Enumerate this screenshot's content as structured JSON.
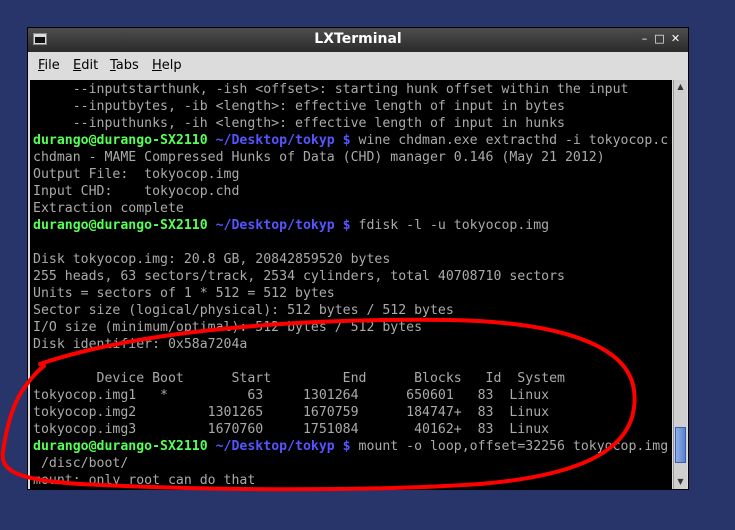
{
  "window": {
    "title": "LXTerminal",
    "buttons": {
      "minimize": "–",
      "maximize": "□",
      "close": "✕"
    }
  },
  "menu": [
    {
      "label": "File",
      "u": "F",
      "rest": "ile"
    },
    {
      "label": "Edit",
      "u": "E",
      "rest": "dit"
    },
    {
      "label": "Tabs",
      "u": "T",
      "rest": "abs"
    },
    {
      "label": "Help",
      "u": "H",
      "rest": "elp"
    }
  ],
  "prompt": {
    "user": "durango@durango-SX2110",
    "path": " ~/Desktop/tokyp $"
  },
  "lines": [
    {
      "text": "     --inputstarthunk, -ish <offset>: starting hunk offset within the input"
    },
    {
      "text": "     --inputbytes, -ib <length>: effective length of input in bytes"
    },
    {
      "text": "     --inputhunks, -ih <length>: effective length of input in hunks"
    },
    {
      "cmd": " wine chdman.exe extracthd -i tokyocop.c"
    },
    {
      "text": "chdman - MAME Compressed Hunks of Data (CHD) manager 0.146 (May 21 2012)"
    },
    {
      "text": "Output File:  tokyocop.img"
    },
    {
      "text": "Input CHD:    tokyocop.chd"
    },
    {
      "text": "Extraction complete"
    },
    {
      "cmd": " fdisk -l -u tokyocop.img"
    },
    {
      "text": ""
    },
    {
      "text": "Disk tokyocop.img: 20.8 GB, 20842859520 bytes"
    },
    {
      "text": "255 heads, 63 sectors/track, 2534 cylinders, total 40708710 sectors"
    },
    {
      "text": "Units = sectors of 1 * 512 = 512 bytes"
    },
    {
      "text": "Sector size (logical/physical): 512 bytes / 512 bytes"
    },
    {
      "text": "I/O size (minimum/optimal): 512 bytes / 512 bytes"
    },
    {
      "text": "Disk identifier: 0x58a7204a"
    },
    {
      "text": ""
    },
    {
      "text": "        Device Boot      Start         End      Blocks   Id  System"
    },
    {
      "text": "tokyocop.img1   *          63     1301264      650601   83  Linux"
    },
    {
      "text": "tokyocop.img2         1301265     1670759      184747+  83  Linux"
    },
    {
      "text": "tokyocop.img3         1670760     1751084       40162+  83  Linux"
    },
    {
      "cmd": " mount -o loop,offset=32256 tokyocop.img"
    },
    {
      "text": " /disc/boot/"
    },
    {
      "text": "mount: only root can do that"
    }
  ]
}
